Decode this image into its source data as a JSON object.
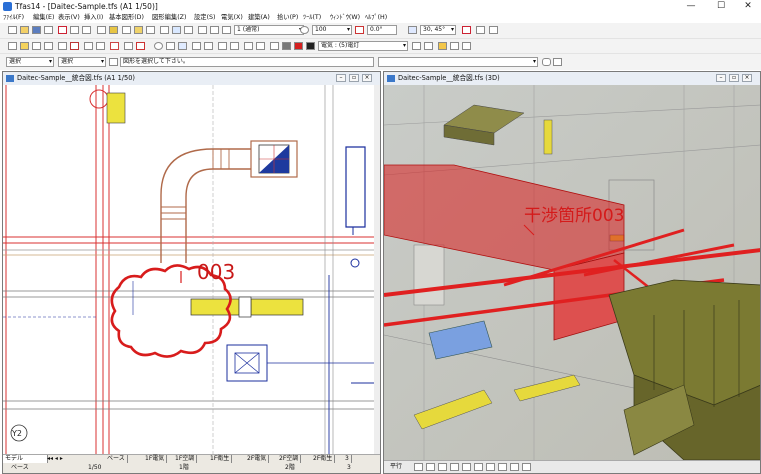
{
  "window": {
    "title": "Tfas14 - [Daitec-Sample.tfs (A1 1/50)]",
    "btn_min": "—",
    "btn_max": "☐",
    "btn_close": "✕"
  },
  "menu": [
    "ﾌｧｲﾙ(F)",
    "編集(E)",
    "表示(V)",
    "挿入(I)",
    "基本図形(D)",
    "図形編集(Z)",
    "設定(S)",
    "電気(X)",
    "建築(A)",
    "拾い(P)",
    "ﾂｰﾙ(T)",
    "ｳｨﾝﾄﾞｳ(W)",
    "ﾍﾙﾌﾟ(H)"
  ],
  "toolbar": {
    "line_style": "1 (通常)",
    "zoom_value": "100",
    "angle_value": "0.0°",
    "snap_angle": "30, 45°",
    "layer_combo": "電気 : (5)電灯",
    "select_mode_1": "選択",
    "select_mode_2": "選択",
    "prompt": "図形を選択して下さい。"
  },
  "left_pane": {
    "title": "Daitec-Sample__統合図.tfs (A1 1/50)",
    "clash_label": "003",
    "grid_label": "Y2",
    "status_model": "モデル",
    "status_base": "ベース",
    "status_scale": "1/50",
    "tabs": [
      "ベース",
      "1F電気",
      "1F空調",
      "1F衛生",
      "2F電気",
      "2F空調",
      "2F衛生",
      "3"
    ],
    "floor_1": "1階",
    "floor_2": "2階",
    "floor_3": "3"
  },
  "right_pane": {
    "title": "Daitec-Sample__統合図.tfs (3D)",
    "clash_label": "干渉箇所003",
    "status_label": "平行"
  },
  "colors": {
    "clash_red": "#d81c1c",
    "duct": "#7b7a32",
    "duct_red": "#e23a3a",
    "drawing_blue": "#1b2f9e"
  }
}
